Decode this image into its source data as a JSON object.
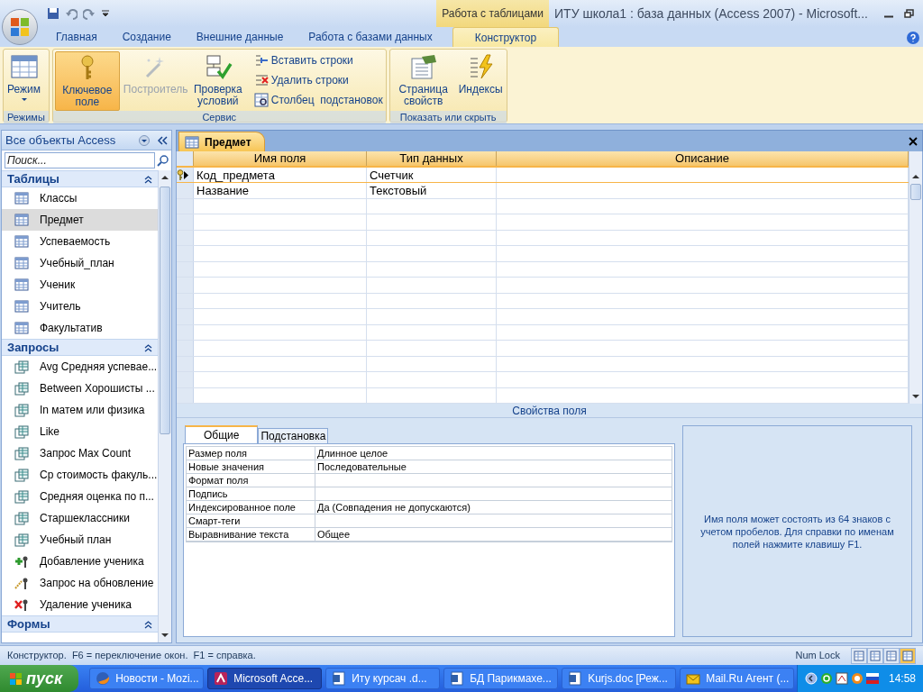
{
  "title_bar": {
    "context_tab": "Работа с таблицами",
    "title": "ИТУ школа1 : база данных (Access 2007) - Microsoft..."
  },
  "ribbon_tabs": [
    {
      "label": "Главная",
      "selected": false
    },
    {
      "label": "Создание",
      "selected": false
    },
    {
      "label": "Внешние данные",
      "selected": false
    },
    {
      "label": "Работа с базами данных",
      "selected": false
    },
    {
      "label": "Конструктор",
      "selected": true
    }
  ],
  "ribbon_groups": [
    {
      "label": "Режимы",
      "buttons": [
        {
          "label": "Режим",
          "kind": "view",
          "selected": false,
          "disabled": false
        }
      ]
    },
    {
      "label": "Сервис",
      "buttons": [
        {
          "label": "Ключевое поле",
          "kind": "key",
          "selected": true,
          "disabled": false
        },
        {
          "label": "Построитель",
          "kind": "wand",
          "selected": false,
          "disabled": true
        },
        {
          "label": "Проверка условий",
          "kind": "check",
          "selected": false,
          "disabled": false
        },
        {
          "label": "Вставить строки",
          "kind": "insert",
          "selected": false,
          "disabled": false
        },
        {
          "label": "Удалить строки",
          "kind": "delete",
          "selected": false,
          "disabled": false
        },
        {
          "label": "Столбец  подстановок",
          "kind": "lookup",
          "selected": false,
          "disabled": false
        }
      ]
    },
    {
      "label": "Показать или скрыть",
      "buttons": [
        {
          "label": "Страница свойств",
          "kind": "sheet",
          "selected": false,
          "disabled": false
        },
        {
          "label": "Индексы",
          "kind": "bolt",
          "selected": false,
          "disabled": false
        }
      ]
    }
  ],
  "nav_pane": {
    "title": "Все объекты Access",
    "search_placeholder": "Поиск...",
    "groups": [
      {
        "label": "Таблицы",
        "items": [
          {
            "label": "Классы",
            "kind": "table",
            "selected": false
          },
          {
            "label": "Предмет",
            "kind": "table",
            "selected": true
          },
          {
            "label": "Успеваемость",
            "kind": "table",
            "selected": false
          },
          {
            "label": "Учебный_план",
            "kind": "table",
            "selected": false
          },
          {
            "label": "Ученик",
            "kind": "table",
            "selected": false
          },
          {
            "label": "Учитель",
            "kind": "table",
            "selected": false
          },
          {
            "label": "Факультатив",
            "kind": "table",
            "selected": false
          }
        ]
      },
      {
        "label": "Запросы",
        "items": [
          {
            "label": "Avg Средняя успевае...",
            "kind": "query",
            "selected": false
          },
          {
            "label": "Between Хорошисты ...",
            "kind": "query",
            "selected": false
          },
          {
            "label": "In матем или физика",
            "kind": "query",
            "selected": false
          },
          {
            "label": "Like",
            "kind": "query",
            "selected": false
          },
          {
            "label": "Запрос Max Count",
            "kind": "query",
            "selected": false
          },
          {
            "label": "Ср стоимость факуль...",
            "kind": "query",
            "selected": false
          },
          {
            "label": "Средняя оценка по п...",
            "kind": "query",
            "selected": false
          },
          {
            "label": "Старшеклассники",
            "kind": "query",
            "selected": false
          },
          {
            "label": "Учебный план",
            "kind": "query",
            "selected": false
          },
          {
            "label": "Добавление ученика",
            "kind": "append",
            "selected": false
          },
          {
            "label": "Запрос на обновление",
            "kind": "update",
            "selected": false
          },
          {
            "label": "Удаление ученика",
            "kind": "delete",
            "selected": false
          }
        ]
      },
      {
        "label": "Формы"
      }
    ]
  },
  "document": {
    "tab": "Предмет",
    "columns": [
      "Имя поля",
      "Тип данных",
      "Описание"
    ],
    "rows": [
      {
        "field": "Код_предмета",
        "type": "Счетчик",
        "primary_key": true,
        "current": true
      },
      {
        "field": "Название",
        "type": "Текстовый",
        "primary_key": false,
        "current": false
      }
    ]
  },
  "field_properties": {
    "title": "Свойства поля",
    "tabs": [
      {
        "label": "Общие",
        "selected": true
      },
      {
        "label": "Подстановка",
        "selected": false
      }
    ],
    "rows": [
      {
        "name": "Размер поля",
        "value": "Длинное целое"
      },
      {
        "name": "Новые значения",
        "value": "Последовательные"
      },
      {
        "name": "Формат поля"
      },
      {
        "name": "Подпись"
      },
      {
        "name": "Индексированное поле",
        "value": "Да (Совпадения не допускаются)"
      },
      {
        "name": "Смарт-теги"
      },
      {
        "name": "Выравнивание текста",
        "value": "Общее"
      }
    ],
    "help": "Имя поля может состоять из 64 знаков с учетом пробелов.  Для справки по именам полей нажмите клавишу F1."
  },
  "status_bar": {
    "text": "Конструктор.  F6 = переключение окон.  F1 = справка.",
    "indicator": "Num Lock"
  },
  "taskbar": {
    "start": "пуск",
    "tasks": [
      {
        "label": "Новости - Mozi...",
        "kind": "browser",
        "selected": false
      },
      {
        "label": "Microsoft Acce...",
        "kind": "access",
        "selected": true
      },
      {
        "label": "Иту курсач .d...",
        "kind": "word",
        "selected": false
      },
      {
        "label": "БД Парикмахе...",
        "kind": "word",
        "selected": false
      },
      {
        "label": "Kurjs.doc [Реж...",
        "kind": "word",
        "selected": false
      },
      {
        "label": "Mail.Ru Агент (...",
        "kind": "mail",
        "selected": false
      }
    ],
    "clock": "14:58"
  }
}
